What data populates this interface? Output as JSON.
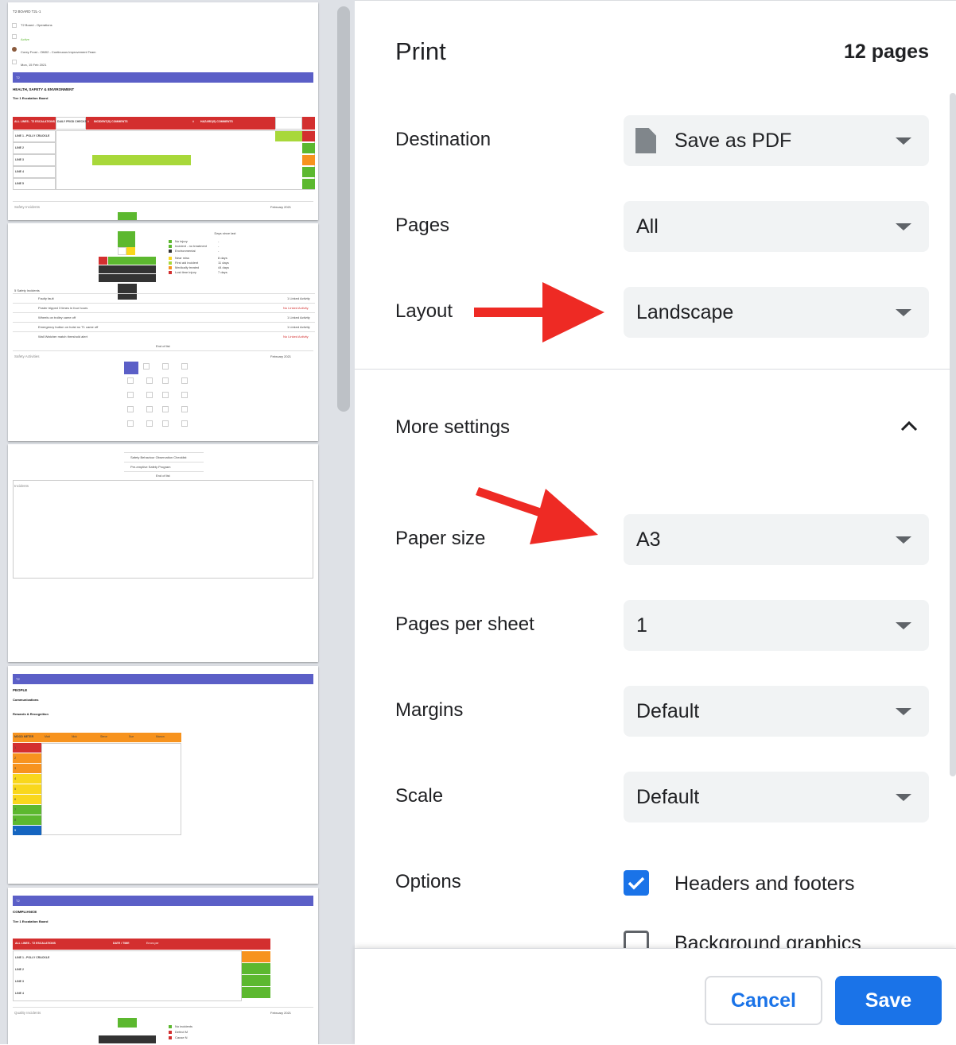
{
  "dialog": {
    "title": "Print",
    "page_count": "12 pages"
  },
  "settings": {
    "destination": {
      "label": "Destination",
      "value": "Save as PDF",
      "icon": "document-icon"
    },
    "pages": {
      "label": "Pages",
      "value": "All"
    },
    "layout": {
      "label": "Layout",
      "value": "Landscape"
    },
    "more_settings": {
      "label": "More settings",
      "expanded": true
    },
    "paper_size": {
      "label": "Paper size",
      "value": "A3"
    },
    "pages_per_sheet": {
      "label": "Pages per sheet",
      "value": "1"
    },
    "margins": {
      "label": "Margins",
      "value": "Default"
    },
    "scale": {
      "label": "Scale",
      "value": "Default"
    },
    "options": {
      "label": "Options",
      "headers_and_footers": {
        "label": "Headers and footers",
        "checked": true
      },
      "background_graphics": {
        "label": "Background graphics",
        "checked": false
      }
    }
  },
  "buttons": {
    "cancel": "Cancel",
    "save": "Save"
  },
  "preview": {
    "page1": {
      "board": "T2 BOARD T2L-1",
      "subtitle": "T2 Board - Operations",
      "status": "Active",
      "assignee": "Corey Frost - OM02 - Continuous Improvement Team",
      "date": "Mon, 15 Feb 2021",
      "band_label": "T2",
      "section": "HEALTH, SAFETY & ENVIRONMENT",
      "subsection": "Tier 1 Escalation Board",
      "table_headers": [
        "ALL LINES - T2 ESCALATIONS",
        "DAILY PROD CHECKS",
        "#",
        "INCIDENT(S) COMMENTS",
        "#",
        "HAZARD(S) COMMENTS"
      ],
      "rows": [
        "LINE 1 - POLLY CRACKLE",
        "LINE 2",
        "LINE 3",
        "LINE 4",
        "LINE 5"
      ],
      "safety_incidents": "Safety Incidents",
      "month": "February 2021"
    },
    "page2": {
      "legend": [
        "No injury",
        "Incident - no treatment",
        "Environmental",
        "Near miss",
        "First aid incident",
        "Medically treated",
        "Lost time injury"
      ],
      "days_header": "Days since last",
      "days": [
        "-",
        "-",
        "-",
        "8 days",
        "11 days",
        "44 days",
        "7 days"
      ],
      "list_title": "5 Safety Incidents",
      "incidents": [
        "Faulty fault",
        "Poster tripped 3 times in four hours",
        "Wheels on trolley came off",
        "Emergency button on hoist no T1 came off",
        "Wall Watcher match threshold alert"
      ],
      "links": [
        "1 Linked Activity",
        "No Linked Activity",
        "1 Linked Activity",
        "1 Linked Activity",
        "No Linked Activity"
      ],
      "end": "End of list",
      "activities": "Safety Activities",
      "month": "February 2021"
    },
    "page3": {
      "items": [
        "Safety Behaviour Observation Checklist",
        "Pre-emptive Safety Program"
      ],
      "end": "End of list",
      "incidents": "Incidents"
    },
    "page4": {
      "band_label": "T2",
      "section": "PEOPLE",
      "subsection": "Communications",
      "subsection2": "Rewards & Recognition",
      "mood": "MOOD METER",
      "people": [
        "Matt",
        "Nick",
        "Steve",
        "Sue",
        "Manon"
      ],
      "levels": [
        "1",
        "2",
        "3",
        "4",
        "5",
        "6",
        "7",
        "8",
        "9"
      ]
    },
    "page5": {
      "band_label": "T2",
      "section": "COMPLIANCE",
      "subsection": "Tier 1 Escalation Board",
      "headers": [
        "ALL LINES - T2 ESCALATIONS",
        "DATE / TIME",
        "Errors per"
      ],
      "rows": [
        "LINE 1 - POLLY CRACKLE",
        "LINE 2",
        "LINE 3",
        "LINE 4"
      ],
      "quality": "Quality Incidents",
      "month": "February 2021",
      "legend": [
        "No incidents",
        "Defect M",
        "Cause N"
      ]
    }
  },
  "colors": {
    "accent": "#1a73e8",
    "annotation_arrow": "#ee2a24",
    "band": "#5b5fc7"
  }
}
